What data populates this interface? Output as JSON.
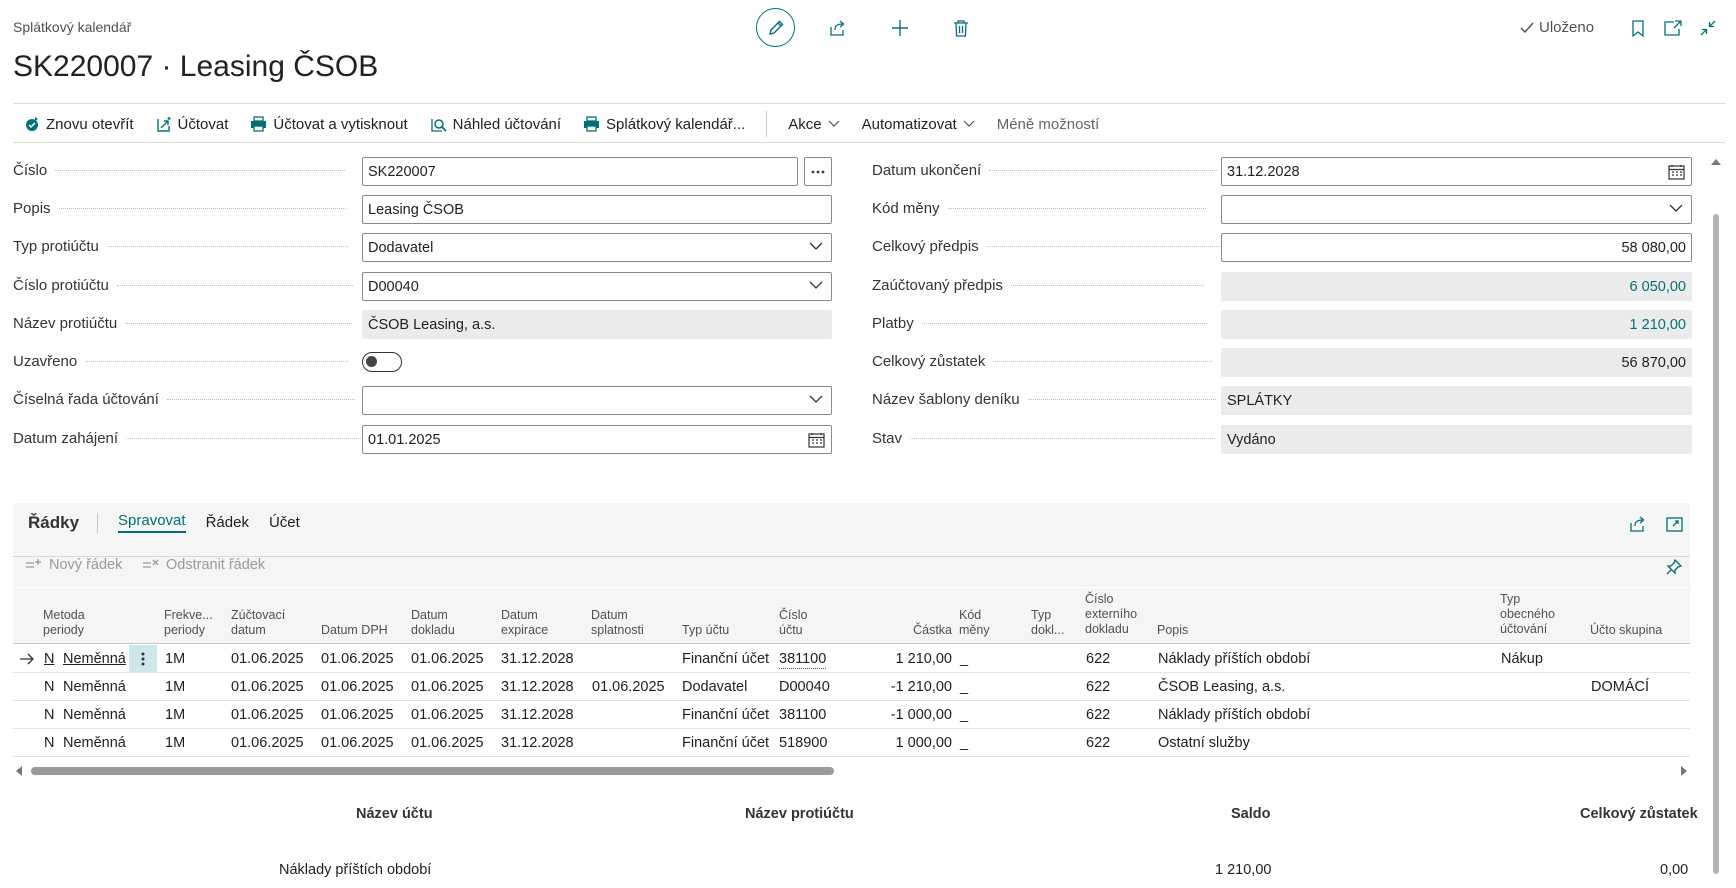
{
  "header": {
    "breadcrumb": "Splátkový kalendář",
    "title": "SK220007 · Leasing ČSOB",
    "saved_label": "Uloženo"
  },
  "actions": {
    "reopen": "Znovu otevřít",
    "post": "Účtovat",
    "post_print": "Účtovat a vytisknout",
    "preview": "Náhled účtování",
    "schedule": "Splátkový kalendář...",
    "akce": "Akce",
    "automate": "Automatizovat",
    "less": "Méně možností"
  },
  "form": {
    "left": [
      {
        "label": "Číslo",
        "value": "SK220007"
      },
      {
        "label": "Popis",
        "value": "Leasing ČSOB"
      },
      {
        "label": "Typ protiúčtu",
        "value": "Dodavatel"
      },
      {
        "label": "Číslo protiúčtu",
        "value": "D00040"
      },
      {
        "label": "Název protiúčtu",
        "value": "ČSOB Leasing, a.s."
      },
      {
        "label": "Uzavřeno",
        "value": ""
      },
      {
        "label": "Číselná řada účtování",
        "value": ""
      },
      {
        "label": "Datum zahájení",
        "value": "01.01.2025"
      }
    ],
    "right": [
      {
        "label": "Datum ukončení",
        "value": "31.12.2028"
      },
      {
        "label": "Kód měny",
        "value": ""
      },
      {
        "label": "Celkový předpis",
        "value": "58 080,00"
      },
      {
        "label": "Zaúčtovaný předpis",
        "value": "6 050,00"
      },
      {
        "label": "Platby",
        "value": "1 210,00"
      },
      {
        "label": "Celkový zůstatek",
        "value": "56 870,00"
      },
      {
        "label": "Název šablony deníku",
        "value": "SPLÁTKY"
      },
      {
        "label": "Stav",
        "value": "Vydáno"
      }
    ]
  },
  "lines": {
    "heading": "Řádky",
    "tabs": [
      "Spravovat",
      "Řádek",
      "Účet"
    ],
    "new_line": "Nový řádek",
    "delete_line": "Odstranit řádek",
    "columns": {
      "method": [
        "Metoda",
        "periody"
      ],
      "freq": [
        "Frekve...",
        "periody"
      ],
      "posting_date": [
        "Zúčtovací",
        "datum"
      ],
      "vat_date": [
        "Datum DPH"
      ],
      "doc_date": [
        "Datum",
        "dokladu"
      ],
      "exp_date": [
        "Datum",
        "expirace"
      ],
      "due_date": [
        "Datum",
        "splatnosti"
      ],
      "acc_type": [
        "Typ účtu"
      ],
      "acc_no": [
        "Číslo",
        "účtu"
      ],
      "amount": [
        "Částka"
      ],
      "currency": [
        "Kód",
        "měny"
      ],
      "doc_type": [
        "Typ",
        "dokl..."
      ],
      "ext_doc": [
        "Číslo",
        "externího",
        "dokladu"
      ],
      "desc": [
        "Popis"
      ],
      "gen_type": [
        "Typ",
        "obecného",
        "účtování"
      ],
      "group": [
        "Účto skupina"
      ]
    },
    "rows": [
      {
        "method_n": "N",
        "method": "Neměnná",
        "freq": "1M",
        "posting_date": "01.06.2025",
        "vat_date": "01.06.2025",
        "doc_date": "01.06.2025",
        "exp_date": "31.12.2028",
        "due_date": "",
        "acc_type": "Finanční účet",
        "acc_no": "381100",
        "amount": "1 210,00",
        "currency": "_",
        "doc_type": "",
        "ext_doc": "622",
        "desc": "Náklady příštích období",
        "gen_type": "Nákup",
        "group": ""
      },
      {
        "method_n": "N",
        "method": "Neměnná",
        "freq": "1M",
        "posting_date": "01.06.2025",
        "vat_date": "01.06.2025",
        "doc_date": "01.06.2025",
        "exp_date": "31.12.2028",
        "due_date": "01.06.2025",
        "acc_type": "Dodavatel",
        "acc_no": "D00040",
        "amount": "-1 210,00",
        "currency": "_",
        "doc_type": "",
        "ext_doc": "622",
        "desc": "ČSOB Leasing, a.s.",
        "gen_type": "",
        "group": "DOMÁCÍ"
      },
      {
        "method_n": "N",
        "method": "Neměnná",
        "freq": "1M",
        "posting_date": "01.06.2025",
        "vat_date": "01.06.2025",
        "doc_date": "01.06.2025",
        "exp_date": "31.12.2028",
        "due_date": "",
        "acc_type": "Finanční účet",
        "acc_no": "381100",
        "amount": "-1 000,00",
        "currency": "_",
        "doc_type": "",
        "ext_doc": "622",
        "desc": "Náklady příštích období",
        "gen_type": "",
        "group": ""
      },
      {
        "method_n": "N",
        "method": "Neměnná",
        "freq": "1M",
        "posting_date": "01.06.2025",
        "vat_date": "01.06.2025",
        "doc_date": "01.06.2025",
        "exp_date": "31.12.2028",
        "due_date": "",
        "acc_type": "Finanční účet",
        "acc_no": "518900",
        "amount": "1 000,00",
        "currency": "_",
        "doc_type": "",
        "ext_doc": "622",
        "desc": "Ostatní služby",
        "gen_type": "",
        "group": ""
      }
    ]
  },
  "footer": {
    "acc_name_label": "Název účtu",
    "bal_acc_name_label": "Název protiúčtu",
    "balance_label": "Saldo",
    "total_label": "Celkový zůstatek",
    "acc_name": "Náklady příštích období",
    "bal_acc_name": "",
    "balance": "1 210,00",
    "total": "0,00"
  },
  "colors": {
    "accent": "#00707a",
    "readonly_bg": "#ebebeb"
  }
}
